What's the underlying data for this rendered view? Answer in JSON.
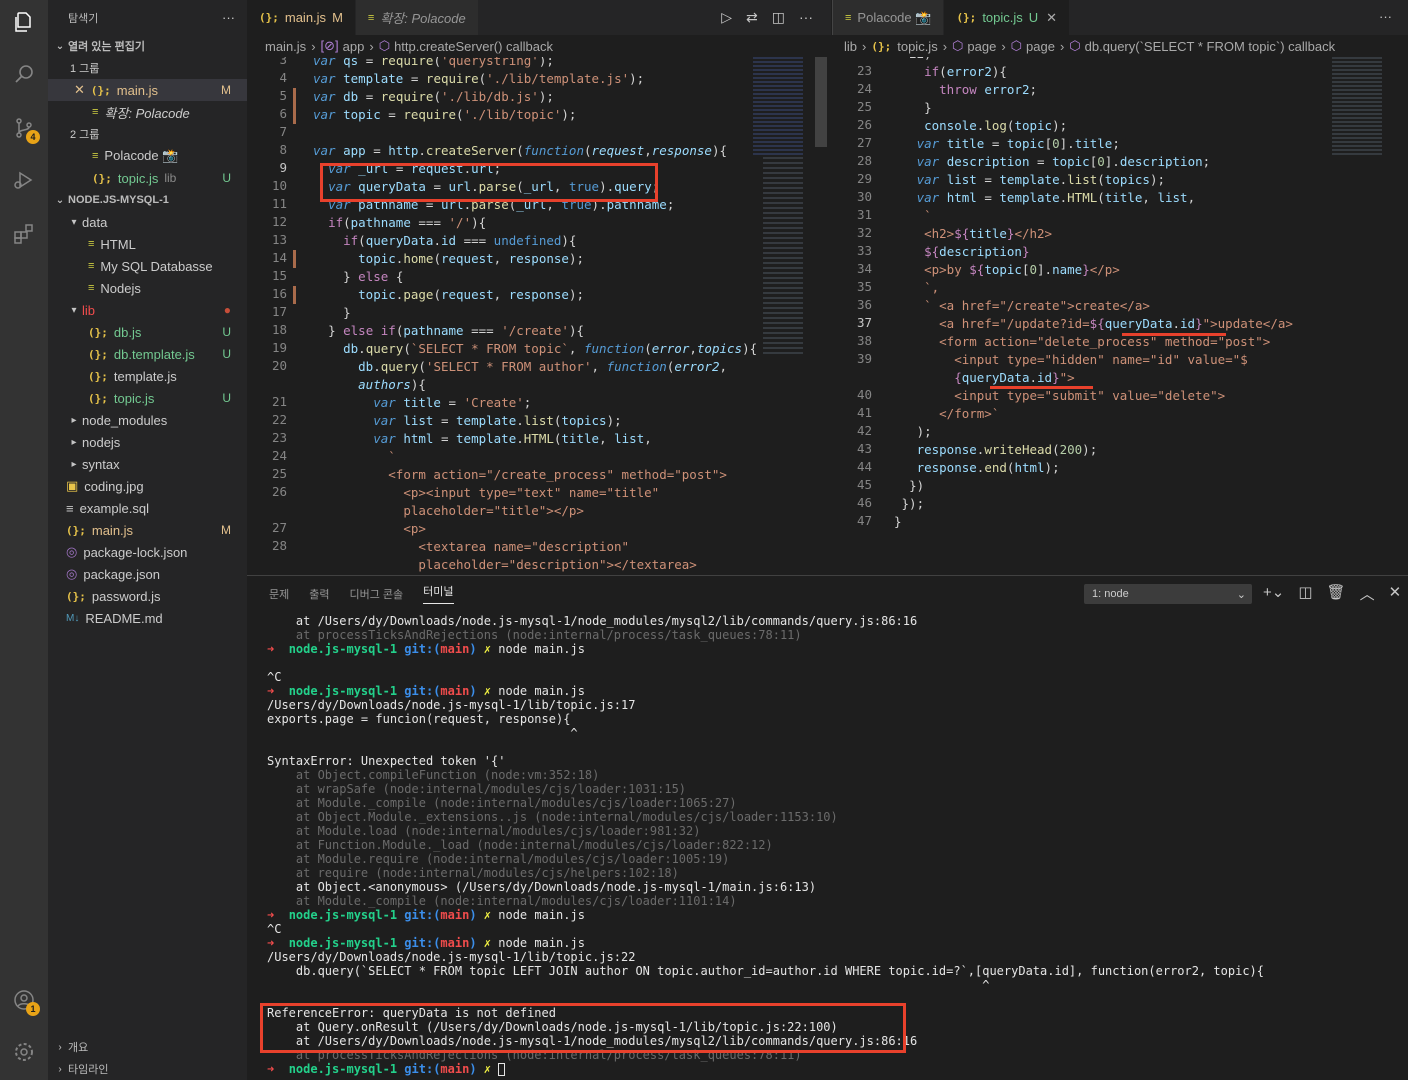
{
  "sidebar": {
    "title": "탐색기",
    "open_editors_title": "열려 있는 편집기",
    "group1": "1 그룹",
    "group2": "2 그룹",
    "open_editors": [
      {
        "name": "main.js",
        "status": "M",
        "selected": true
      },
      {
        "name": "확장: Polacode",
        "status": ""
      },
      {
        "name": "Polacode 📸",
        "status": ""
      },
      {
        "name": "topic.js",
        "dir": "lib",
        "status": "U"
      }
    ],
    "workspace_title": "NODE.JS-MYSQL-1",
    "tree": [
      {
        "label": "data",
        "kind": "folder"
      },
      {
        "label": "HTML",
        "kind": "md"
      },
      {
        "label": "My SQL Databasse",
        "kind": "md"
      },
      {
        "label": "Nodejs",
        "kind": "md"
      },
      {
        "label": "lib",
        "kind": "folder-red"
      },
      {
        "label": "db.js",
        "kind": "js",
        "status": "U"
      },
      {
        "label": "db.template.js",
        "kind": "js",
        "status": "U"
      },
      {
        "label": "template.js",
        "kind": "js"
      },
      {
        "label": "topic.js",
        "kind": "js",
        "status": "U"
      },
      {
        "label": "node_modules",
        "kind": "folder-closed"
      },
      {
        "label": "nodejs",
        "kind": "folder-closed"
      },
      {
        "label": "syntax",
        "kind": "folder-closed"
      },
      {
        "label": "coding.jpg",
        "kind": "img"
      },
      {
        "label": "example.sql",
        "kind": "db"
      },
      {
        "label": "main.js",
        "kind": "js",
        "status": "M"
      },
      {
        "label": "package-lock.json",
        "kind": "json"
      },
      {
        "label": "package.json",
        "kind": "json"
      },
      {
        "label": "password.js",
        "kind": "js"
      },
      {
        "label": "README.md",
        "kind": "readme"
      }
    ],
    "outline": "개요",
    "timeline": "타임라인"
  },
  "left_editor": {
    "tabs": [
      {
        "label": "main.js",
        "status": "M",
        "active": true
      },
      {
        "label": "확장: Polacode",
        "active": false
      }
    ],
    "breadcrumb": [
      "main.js",
      "app",
      "http.createServer() callback"
    ],
    "current_line": "9"
  },
  "right_editor": {
    "tabs": [
      {
        "label": "Polacode 📸",
        "active": false
      },
      {
        "label": "topic.js",
        "status": "U",
        "active": true
      }
    ],
    "breadcrumb": [
      "lib",
      "topic.js",
      "page",
      "page",
      "db.query(`SELECT * FROM topic`) callback"
    ],
    "current_line": "37"
  },
  "panel": {
    "tabs": [
      "문제",
      "출력",
      "디버그 콘솔",
      "터미널"
    ],
    "active_tab": "터미널",
    "terminal_select": "1: node"
  },
  "colors": {
    "accent": "#e8412c",
    "badge": "#e8a317"
  }
}
